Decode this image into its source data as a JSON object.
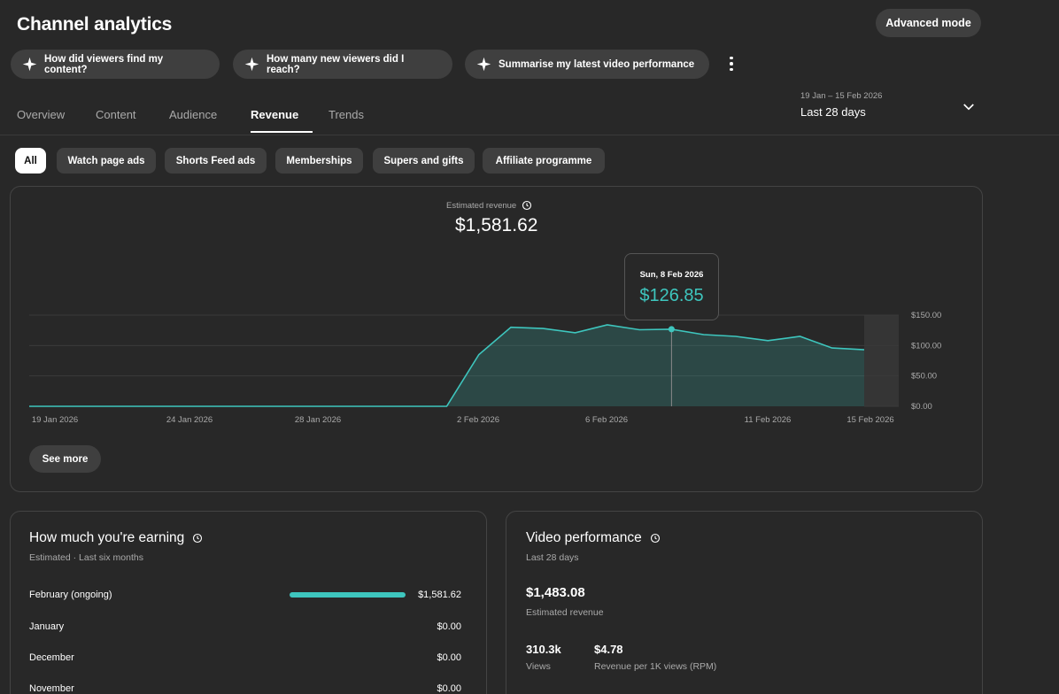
{
  "header": {
    "title": "Channel analytics",
    "advanced_mode": "Advanced mode"
  },
  "prompts": [
    "How did viewers find my content?",
    "How many new viewers did I reach?",
    "Summarise my latest video performance"
  ],
  "tabs": [
    "Overview",
    "Content",
    "Audience",
    "Revenue",
    "Trends"
  ],
  "active_tab": "Revenue",
  "date": {
    "range": "19 Jan – 15 Feb 2026",
    "label": "Last 28 days"
  },
  "filters": [
    "All",
    "Watch page ads",
    "Shorts Feed ads",
    "Memberships",
    "Supers and gifts",
    "Affiliate programme"
  ],
  "active_filter": "All",
  "revenue": {
    "label": "Estimated revenue",
    "value": "$1,581.62",
    "see_more": "See more",
    "tooltip": {
      "date": "Sun, 8 Feb 2026",
      "value": "$126.85"
    }
  },
  "chart_data": {
    "type": "area",
    "x": [
      "19 Jan",
      "20 Jan",
      "21 Jan",
      "22 Jan",
      "23 Jan",
      "24 Jan",
      "25 Jan",
      "26 Jan",
      "27 Jan",
      "28 Jan",
      "29 Jan",
      "30 Jan",
      "31 Jan",
      "1 Feb",
      "2 Feb",
      "3 Feb",
      "4 Feb",
      "5 Feb",
      "6 Feb",
      "7 Feb",
      "8 Feb",
      "9 Feb",
      "10 Feb",
      "11 Feb",
      "12 Feb",
      "13 Feb",
      "14 Feb"
    ],
    "values": [
      0,
      0,
      0,
      0,
      0,
      0,
      0,
      0,
      0,
      0,
      0,
      0,
      0,
      0,
      85,
      130,
      128,
      121,
      134,
      126,
      126.85,
      118,
      115,
      108,
      115,
      96,
      93
    ],
    "x_tick_labels": [
      "19 Jan 2026",
      "24 Jan 2026",
      "28 Jan 2026",
      "2 Feb 2026",
      "6 Feb 2026",
      "11 Feb 2026",
      "15 Feb 2026"
    ],
    "y_tick_labels": [
      "$150.00",
      "$100.00",
      "$50.00",
      "$0.00"
    ],
    "ylim": [
      0,
      150
    ],
    "highlight_index": 20,
    "color": "#3ec6be",
    "grid": true
  },
  "earning": {
    "title": "How much you're earning",
    "subtitle": "Estimated · Last six months",
    "rows": [
      {
        "month": "February (ongoing)",
        "value": "$1,581.62",
        "fraction": 1.0
      },
      {
        "month": "January",
        "value": "$0.00",
        "fraction": 0
      },
      {
        "month": "December",
        "value": "$0.00",
        "fraction": 0
      },
      {
        "month": "November",
        "value": "$0.00",
        "fraction": 0
      }
    ]
  },
  "video_performance": {
    "title": "Video performance",
    "subtitle": "Last 28 days",
    "revenue": "$1,483.08",
    "revenue_label": "Estimated revenue",
    "views": "310.3k",
    "views_label": "Views",
    "rpm": "$4.78",
    "rpm_label": "Revenue per 1K views (RPM)"
  }
}
